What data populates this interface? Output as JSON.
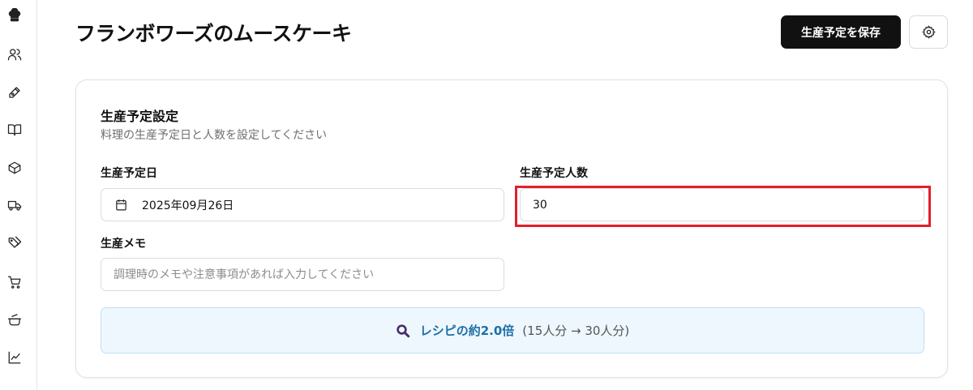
{
  "sidebar": {
    "items": [
      {
        "icon": "chef-hat-icon"
      },
      {
        "icon": "users-icon"
      },
      {
        "icon": "pen-icon"
      },
      {
        "icon": "book-icon"
      },
      {
        "icon": "box-icon"
      },
      {
        "icon": "truck-icon"
      },
      {
        "icon": "tags-icon"
      },
      {
        "icon": "cart-icon"
      },
      {
        "icon": "pot-icon"
      },
      {
        "icon": "chart-icon"
      }
    ]
  },
  "header": {
    "title": "フランボワーズのムースケーキ",
    "save_label": "生産予定を保存",
    "settings_icon": "gear-icon"
  },
  "card": {
    "title": "生産予定設定",
    "description": "料理の生産予定日と人数を設定してください",
    "date_label": "生産予定日",
    "date_value": "2025年09月26日",
    "people_label": "生産予定人数",
    "people_value": "30",
    "memo_label": "生産メモ",
    "memo_placeholder": "調理時のメモや注意事項があれば入力してください",
    "scale_main": "レシピの約2.0倍",
    "scale_detail": "(15人分 → 30人分)"
  },
  "colors": {
    "accent_blue": "#1d6fa8",
    "highlight_red": "#e0202a",
    "info_bg": "#eef7fd",
    "magnifier": "#4a2d6b"
  }
}
